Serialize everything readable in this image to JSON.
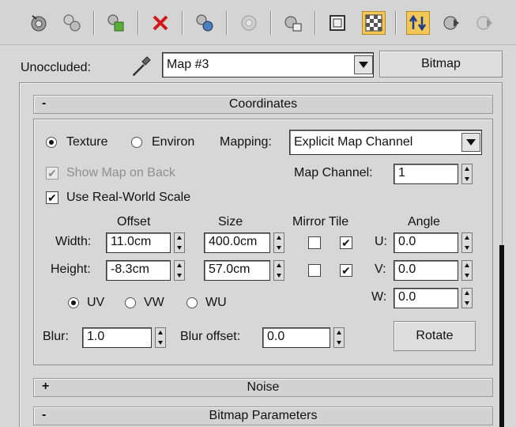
{
  "toolbar": {
    "buttons": [
      {
        "icon": "sample-icon"
      },
      {
        "icon": "get-material-icon"
      },
      {
        "icon": "put-to-scene-icon"
      },
      {
        "icon": "delete-icon"
      },
      {
        "icon": "make-unique-icon"
      },
      {
        "icon": "put-to-library-icon"
      },
      {
        "icon": "material-id-icon"
      },
      {
        "icon": "show-map-icon"
      },
      {
        "icon": "background-icon"
      },
      {
        "icon": "go-to-parent-icon"
      },
      {
        "icon": "go-forward-icon"
      },
      {
        "icon": "go-to-sibling-icon"
      }
    ],
    "accent": "#f2c75a"
  },
  "unoccluded": {
    "label": "Unoccluded:",
    "map_value": "Map #3",
    "bitmap_button": "Bitmap"
  },
  "coordinates": {
    "rollout_sign": "-",
    "title": "Coordinates",
    "texture_label": "Texture",
    "environ_label": "Environ",
    "mapping_label": "Mapping:",
    "mapping_value": "Explicit Map Channel",
    "show_map_on_back": "Show Map on Back",
    "map_channel_label": "Map Channel:",
    "map_channel_value": "1",
    "use_real_world_scale": "Use Real-World Scale",
    "headers": {
      "offset": "Offset",
      "size": "Size",
      "mirror_tile": "Mirror Tile",
      "angle": "Angle"
    },
    "width_label": "Width:",
    "width_offset": "11.0cm",
    "width_size": "400.0cm",
    "height_label": "Height:",
    "height_offset": "-8.3cm",
    "height_size": "57.0cm",
    "u_label": "U:",
    "u_value": "0.0",
    "v_label": "V:",
    "v_value": "0.0",
    "w_label": "W:",
    "w_value": "0.0",
    "uv_label": "UV",
    "vw_label": "VW",
    "wu_label": "WU",
    "blur_label": "Blur:",
    "blur_value": "1.0",
    "blur_offset_label": "Blur offset:",
    "blur_offset_value": "0.0",
    "rotate_button": "Rotate"
  },
  "noise": {
    "sign": "+",
    "title": "Noise"
  },
  "bitmap_parameters": {
    "sign": "-",
    "title": "Bitmap Parameters"
  }
}
